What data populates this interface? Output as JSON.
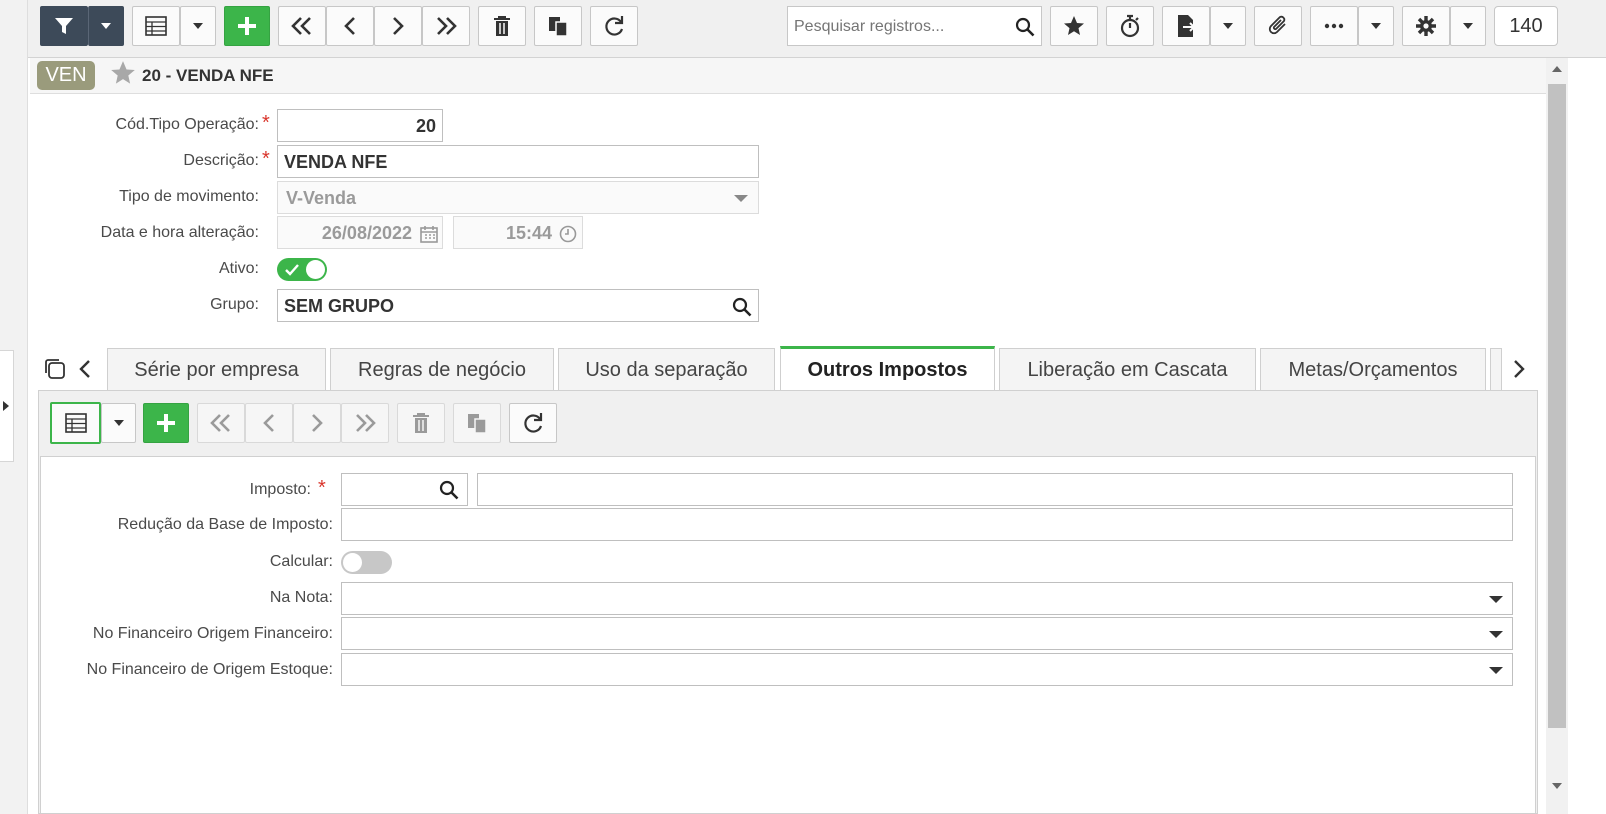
{
  "toolbar": {
    "search_placeholder": "Pesquisar registros...",
    "record_count": "140"
  },
  "header": {
    "badge": "VEN",
    "title": "20 - VENDA NFE"
  },
  "form": {
    "cod_tipo_label": "Cód.Tipo Operação:",
    "cod_tipo_value": "20",
    "descricao_label": "Descrição:",
    "descricao_value": "VENDA NFE",
    "tipo_mov_label": "Tipo de movimento:",
    "tipo_mov_value": "V-Venda",
    "data_label": "Data e hora alteração:",
    "data_value": "26/08/2022",
    "hora_value": "15:44",
    "ativo_label": "Ativo:",
    "ativo_on": true,
    "grupo_label": "Grupo:",
    "grupo_value": "SEM GRUPO"
  },
  "tabs": [
    {
      "label": "Série por empresa",
      "active": false
    },
    {
      "label": "Regras de negócio",
      "active": false
    },
    {
      "label": "Uso da separação",
      "active": false
    },
    {
      "label": "Outros Impostos",
      "active": true
    },
    {
      "label": "Liberação em Cascata",
      "active": false
    },
    {
      "label": "Metas/Orçamentos",
      "active": false
    }
  ],
  "detail": {
    "imposto_label": "Imposto:",
    "reducao_label": "Redução da Base de Imposto:",
    "calcular_label": "Calcular:",
    "calcular_on": false,
    "na_nota_label": "Na Nota:",
    "fin_origem_fin_label": "No Financeiro Origem Financeiro:",
    "fin_origem_est_label": "No Financeiro de Origem Estoque:"
  },
  "colors": {
    "accent_green": "#3cb54a",
    "dark_button": "#3d4a59",
    "badge_bg": "#9a9b7c",
    "required": "#d9342b"
  }
}
